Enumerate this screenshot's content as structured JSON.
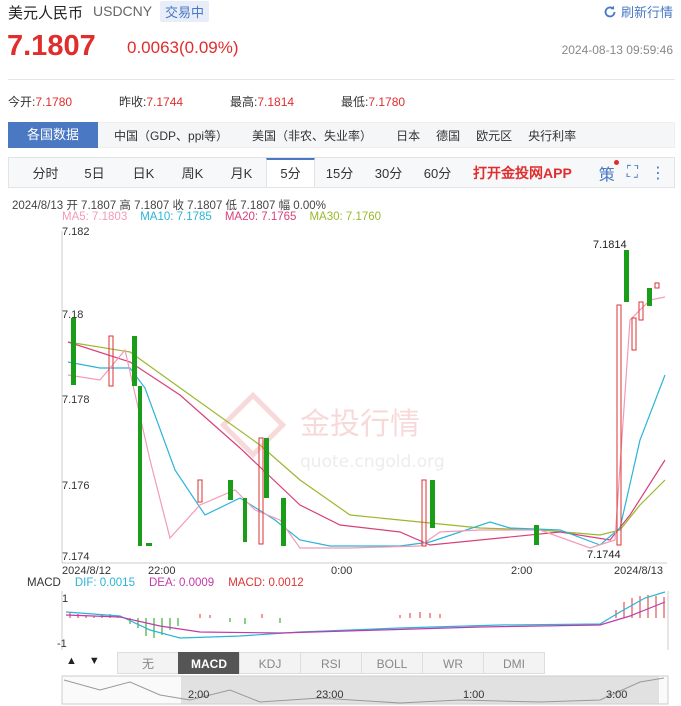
{
  "header": {
    "name": "美元人民币",
    "code": "USDCNY",
    "status": "交易中",
    "refresh": "刷新行情",
    "price": "7.1807",
    "change": "0.0063(0.09%)",
    "time": "2024-08-13 09:59:46"
  },
  "stats": [
    {
      "label": "今开:",
      "value": "7.1780"
    },
    {
      "label": "昨收:",
      "value": "7.1744"
    },
    {
      "label": "最高:",
      "value": "7.1814"
    },
    {
      "label": "最低:",
      "value": "7.1780"
    }
  ],
  "categories": {
    "active": "各国数据",
    "items": [
      "中国（GDP、ppi等）",
      "美国（非农、失业率）",
      "日本",
      "德国",
      "欧元区",
      "央行利率"
    ]
  },
  "tabs": {
    "items": [
      "分时",
      "5日",
      "日K",
      "周K",
      "月K",
      "5分",
      "15分",
      "30分",
      "60分"
    ],
    "active_index": 5,
    "promo": "打开金投网APP"
  },
  "ohlc": "2024/8/13  开 7.1807  高 7.1807  收 7.1807  低 7.1807  幅 0.00%",
  "ma": [
    {
      "label": "MA5: 7.1803",
      "color": "#f29bb5"
    },
    {
      "label": "MA10: 7.1785",
      "color": "#2ab4d8"
    },
    {
      "label": "MA20: 7.1765",
      "color": "#d8407a"
    },
    {
      "label": "MA30: 7.1760",
      "color": "#9ab82c"
    }
  ],
  "chart_data": {
    "type": "candlestick",
    "y_ticks": [
      "7.182",
      "7.18",
      "7.178",
      "7.176",
      "7.174"
    ],
    "x_ticks": [
      "2024/8/12",
      "22:00",
      "0:00",
      "2:00",
      "2024/8/13"
    ],
    "annotations": [
      "7.1814",
      "7.1744"
    ],
    "watermark": "金投行情",
    "watermark_sub": "quote.cngold.org"
  },
  "macd": {
    "title": "MACD",
    "dif": "DIF: 0.0015",
    "dea": "DEA: 0.0009",
    "macd": "MACD: 0.0012",
    "y_ticks": [
      "1",
      "-1"
    ]
  },
  "indicator_buttons": {
    "items": [
      "无",
      "MACD",
      "KDJ",
      "RSI",
      "BOLL",
      "WR",
      "DMI"
    ],
    "active_index": 1
  },
  "navigator": {
    "ticks": [
      "2:00",
      "23:00",
      "1:00",
      "3:00"
    ]
  }
}
